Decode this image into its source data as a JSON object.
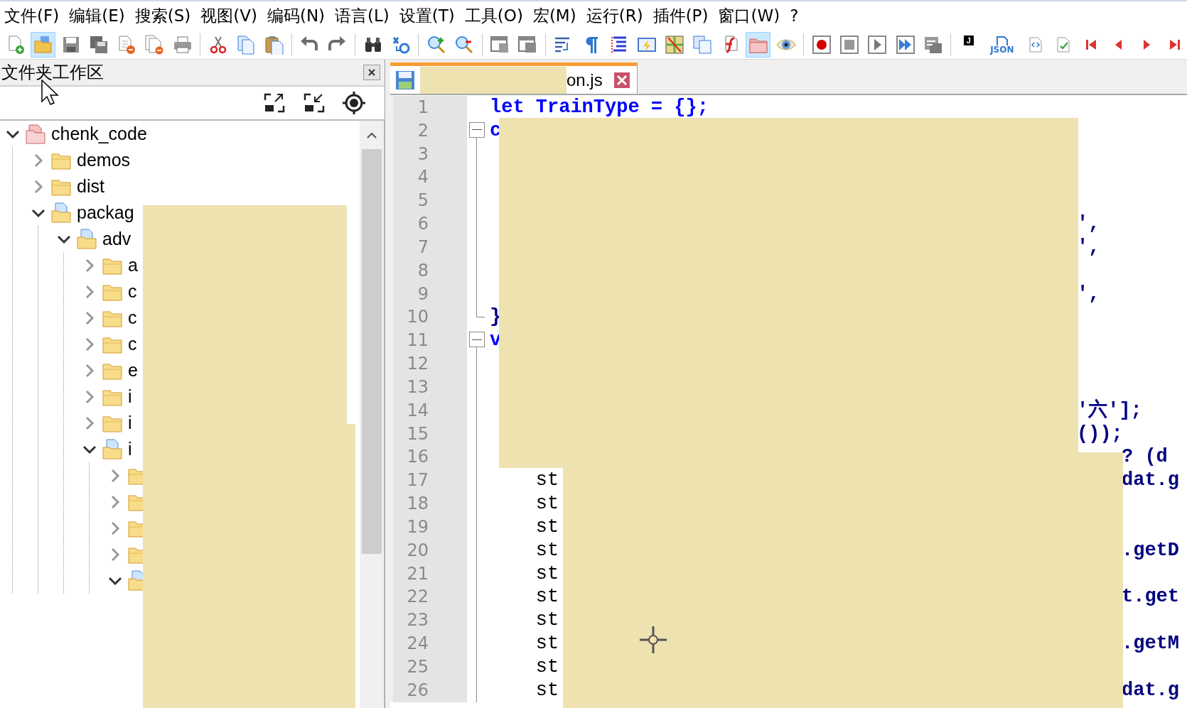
{
  "menu": [
    {
      "label": "文件(F)"
    },
    {
      "label": "编辑(E)"
    },
    {
      "label": "搜索(S)"
    },
    {
      "label": "视图(V)"
    },
    {
      "label": "编码(N)"
    },
    {
      "label": "语言(L)"
    },
    {
      "label": "设置(T)"
    },
    {
      "label": "工具(O)"
    },
    {
      "label": "宏(M)"
    },
    {
      "label": "运行(R)"
    },
    {
      "label": "插件(P)"
    },
    {
      "label": "窗口(W)"
    },
    {
      "label": "?"
    }
  ],
  "toolbar": {
    "groups": [
      [
        {
          "kind": "new",
          "selected": false
        },
        {
          "kind": "open",
          "selected": true
        },
        {
          "kind": "save",
          "selected": false
        },
        {
          "kind": "save-all",
          "selected": false
        },
        {
          "kind": "close",
          "selected": false
        },
        {
          "kind": "close-all",
          "selected": false
        },
        {
          "kind": "print",
          "selected": false
        }
      ],
      [
        {
          "kind": "cut",
          "selected": false
        },
        {
          "kind": "copy",
          "selected": false
        },
        {
          "kind": "paste",
          "selected": false
        }
      ],
      [
        {
          "kind": "undo",
          "selected": false
        },
        {
          "kind": "redo",
          "selected": false
        }
      ],
      [
        {
          "kind": "find",
          "selected": false
        },
        {
          "kind": "replace",
          "selected": false
        }
      ],
      [
        {
          "kind": "zoom-in",
          "selected": false
        },
        {
          "kind": "zoom-out",
          "selected": false
        }
      ],
      [
        {
          "kind": "sync-vertical",
          "selected": false
        },
        {
          "kind": "sync-horizontal",
          "selected": false
        }
      ],
      [
        {
          "kind": "wrap",
          "selected": false
        },
        {
          "kind": "pilcrow",
          "selected": false
        },
        {
          "kind": "indent-guide",
          "selected": false
        },
        {
          "kind": "lightning",
          "selected": false
        },
        {
          "kind": "map",
          "selected": false
        },
        {
          "kind": "windows",
          "selected": false
        },
        {
          "kind": "function-list",
          "selected": false
        },
        {
          "kind": "folder",
          "selected": true
        },
        {
          "kind": "eye",
          "selected": false
        }
      ],
      [
        {
          "kind": "record",
          "selected": false
        },
        {
          "kind": "stop",
          "selected": false
        },
        {
          "kind": "play",
          "selected": false
        },
        {
          "kind": "play-multiple",
          "selected": false
        },
        {
          "kind": "save-macro",
          "selected": false
        }
      ],
      [
        {
          "kind": "badge",
          "label": "J",
          "selected": false
        },
        {
          "kind": "json",
          "label": "JSON",
          "selected": false
        },
        {
          "kind": "code-doc",
          "selected": false
        },
        {
          "kind": "check-doc",
          "selected": false
        },
        {
          "kind": "first",
          "selected": false
        },
        {
          "kind": "previous",
          "selected": false
        },
        {
          "kind": "next",
          "selected": false
        },
        {
          "kind": "last",
          "selected": false
        }
      ]
    ]
  },
  "panel": {
    "title": "文件夹工作区",
    "tree": [
      {
        "label": "chenk_code",
        "kind": "root",
        "expanded": true,
        "children": [
          {
            "label": "demos",
            "kind": "folder",
            "expanded": false
          },
          {
            "label": "dist",
            "kind": "folder",
            "expanded": false
          },
          {
            "label": "packag",
            "kind": "folder",
            "expanded": true,
            "children": [
              {
                "label": "adv",
                "kind": "folder",
                "expanded": true,
                "children": [
                  {
                    "label": "a",
                    "kind": "folder",
                    "expanded": false
                  },
                  {
                    "label": "c",
                    "kind": "folder",
                    "expanded": false
                  },
                  {
                    "label": "c",
                    "kind": "folder",
                    "expanded": false
                  },
                  {
                    "label": "c",
                    "kind": "folder",
                    "expanded": false
                  },
                  {
                    "label": "e",
                    "kind": "folder",
                    "expanded": false
                  },
                  {
                    "label": "i",
                    "kind": "folder",
                    "expanded": false
                  },
                  {
                    "label": "i",
                    "kind": "folder",
                    "expanded": false
                  },
                  {
                    "label": "i",
                    "kind": "folder",
                    "expanded": true,
                    "children": [
                      {
                        "kind": "folder",
                        "expanded": false
                      },
                      {
                        "kind": "folder",
                        "expanded": false
                      },
                      {
                        "kind": "folder",
                        "expanded": false
                      },
                      {
                        "kind": "folder",
                        "expanded": false
                      },
                      {
                        "kind": "folder",
                        "expanded": true
                      }
                    ]
                  }
                ]
              }
            ]
          }
        ]
      }
    ]
  },
  "editor": {
    "tab": {
      "label": "on.js",
      "selected": true
    },
    "lines": [
      {
        "number": "1",
        "kind": "plain",
        "left": {
          "text": "let TrainType = {};",
          "kind": "keyword"
        }
      },
      {
        "number": "2",
        "kind": "fold-start",
        "left": {
          "text": "c",
          "kind": "keyword"
        }
      },
      {
        "number": "3",
        "kind": "fold-body"
      },
      {
        "number": "4",
        "kind": "fold-body"
      },
      {
        "number": "5",
        "kind": "fold-body"
      },
      {
        "number": "6",
        "kind": "fold-body",
        "right": "',"
      },
      {
        "number": "7",
        "kind": "fold-body",
        "right": "',"
      },
      {
        "number": "8",
        "kind": "fold-body"
      },
      {
        "number": "9",
        "kind": "fold-body",
        "right": "',"
      },
      {
        "number": "10",
        "kind": "fold-end",
        "left": {
          "text": "}",
          "kind": "operator"
        }
      },
      {
        "number": "11",
        "kind": "fold-start",
        "left": {
          "text": "v",
          "kind": "keyword"
        }
      },
      {
        "number": "12",
        "kind": "fold-body"
      },
      {
        "number": "13",
        "kind": "fold-body"
      },
      {
        "number": "14",
        "kind": "fold-body",
        "right": "'六'];"
      },
      {
        "number": "15",
        "kind": "fold-body",
        "right": "());"
      },
      {
        "number": "16",
        "kind": "fold-body",
        "right": "? (d"
      },
      {
        "number": "17",
        "kind": "fold-body",
        "left": {
          "text": "    st",
          "kind": "plain"
        },
        "right": "dat.g"
      },
      {
        "number": "18",
        "kind": "fold-body",
        "left": {
          "text": "    st",
          "kind": "plain"
        }
      },
      {
        "number": "19",
        "kind": "fold-body",
        "left": {
          "text": "    st",
          "kind": "plain"
        }
      },
      {
        "number": "20",
        "kind": "fold-body",
        "left": {
          "text": "    st",
          "kind": "plain"
        },
        "right": ".getD"
      },
      {
        "number": "21",
        "kind": "fold-body",
        "left": {
          "text": "    st",
          "kind": "plain"
        }
      },
      {
        "number": "22",
        "kind": "fold-body",
        "left": {
          "text": "    st",
          "kind": "plain"
        },
        "right": "t.get"
      },
      {
        "number": "23",
        "kind": "fold-body",
        "left": {
          "text": "    st",
          "kind": "plain"
        }
      },
      {
        "number": "24",
        "kind": "fold-body",
        "left": {
          "text": "    st",
          "kind": "plain"
        },
        "right": ".getM"
      },
      {
        "number": "25",
        "kind": "fold-body",
        "left": {
          "text": "    st",
          "kind": "plain"
        }
      },
      {
        "number": "26",
        "kind": "fold-body",
        "left": {
          "text": "    st",
          "kind": "plain"
        },
        "right": "dat.g"
      }
    ]
  }
}
